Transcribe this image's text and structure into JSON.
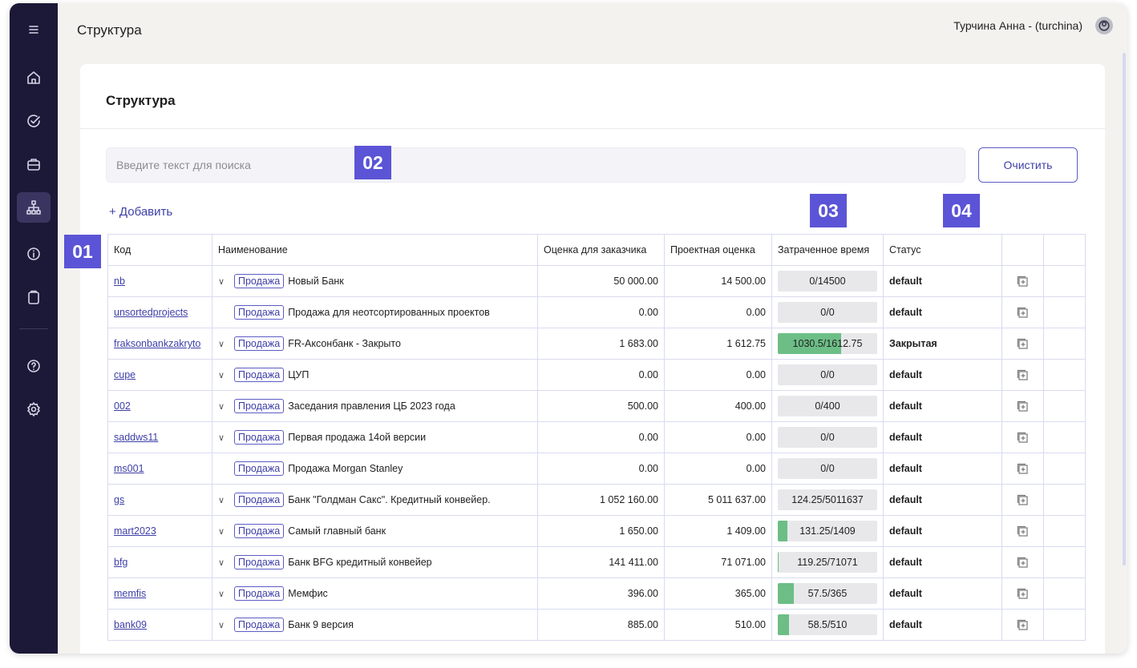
{
  "header": {
    "title": "Структура",
    "user": "Турчина Анна - (turchina)"
  },
  "card": {
    "title": "Структура"
  },
  "search": {
    "placeholder": "Введите текст для поиска",
    "value": ""
  },
  "buttons": {
    "clear": "Очистить",
    "add": "+ Добавить"
  },
  "badges": {
    "b1": "01",
    "b2": "02",
    "b3": "03",
    "b4": "04"
  },
  "sidebar": {
    "items": [
      "menu-icon",
      "home-icon",
      "check-circle-icon",
      "briefcase-icon",
      "hierarchy-icon",
      "info-icon",
      "clipboard-icon",
      "help-icon",
      "gear-icon"
    ],
    "active": "hierarchy-icon"
  },
  "table": {
    "columns": [
      "Код",
      "Наименование",
      "Оценка для заказчика",
      "Проектная оценка",
      "Затраченное время",
      "Статус",
      "",
      ""
    ],
    "rows": [
      {
        "code": "nb",
        "expand": true,
        "tag": "Продажа",
        "name": "Новый Банк",
        "customer": "50 000.00",
        "project": "14 500.00",
        "spent": "0/14500",
        "fill": 0,
        "status": "default"
      },
      {
        "code": "unsortedprojects",
        "expand": false,
        "tag": "Продажа",
        "name": "Продажа для неотсортированных проектов",
        "customer": "0.00",
        "project": "0.00",
        "spent": "0/0",
        "fill": 0,
        "status": "default"
      },
      {
        "code": "fraksonbankzakryto",
        "expand": true,
        "tag": "Продажа",
        "name": "FR-Аксонбанк - Закрыто",
        "customer": "1 683.00",
        "project": "1 612.75",
        "spent": "1030.5/1612.75",
        "fill": 0.64,
        "status": "Закрытая"
      },
      {
        "code": "cupe",
        "expand": true,
        "tag": "Продажа",
        "name": "ЦУП",
        "customer": "0.00",
        "project": "0.00",
        "spent": "0/0",
        "fill": 0,
        "status": "default"
      },
      {
        "code": "002",
        "expand": true,
        "tag": "Продажа",
        "name": "Заседания правления ЦБ 2023 года",
        "customer": "500.00",
        "project": "400.00",
        "spent": "0/400",
        "fill": 0,
        "status": "default"
      },
      {
        "code": "saddws11",
        "expand": true,
        "tag": "Продажа",
        "name": "Первая продажа 14ой версии",
        "customer": "0.00",
        "project": "0.00",
        "spent": "0/0",
        "fill": 0,
        "status": "default"
      },
      {
        "code": "ms001",
        "expand": false,
        "tag": "Продажа",
        "name": "Продажа Morgan Stanley",
        "customer": "0.00",
        "project": "0.00",
        "spent": "0/0",
        "fill": 0,
        "status": "default"
      },
      {
        "code": "gs",
        "expand": true,
        "tag": "Продажа",
        "name": "Банк \"Голдман Сакс\". Кредитный конвейер.",
        "customer": "1 052 160.00",
        "project": "5 011 637.00",
        "spent": "124.25/5011637",
        "fill": 0,
        "status": "default"
      },
      {
        "code": "mart2023",
        "expand": true,
        "tag": "Продажа",
        "name": "Самый главный банк",
        "customer": "1 650.00",
        "project": "1 409.00",
        "spent": "131.25/1409",
        "fill": 0.093,
        "status": "default"
      },
      {
        "code": "bfg",
        "expand": true,
        "tag": "Продажа",
        "name": "Банк BFG кредитный конвейер",
        "customer": "141 411.00",
        "project": "71 071.00",
        "spent": "119.25/71071",
        "fill": 0.0017,
        "status": "default"
      },
      {
        "code": "memfis",
        "expand": true,
        "tag": "Продажа",
        "name": "Мемфис",
        "customer": "396.00",
        "project": "365.00",
        "spent": "57.5/365",
        "fill": 0.158,
        "status": "default"
      },
      {
        "code": "bank09",
        "expand": true,
        "tag": "Продажа",
        "name": "Банк 9 версия",
        "customer": "885.00",
        "project": "510.00",
        "spent": "58.5/510",
        "fill": 0.115,
        "status": "default"
      }
    ]
  }
}
